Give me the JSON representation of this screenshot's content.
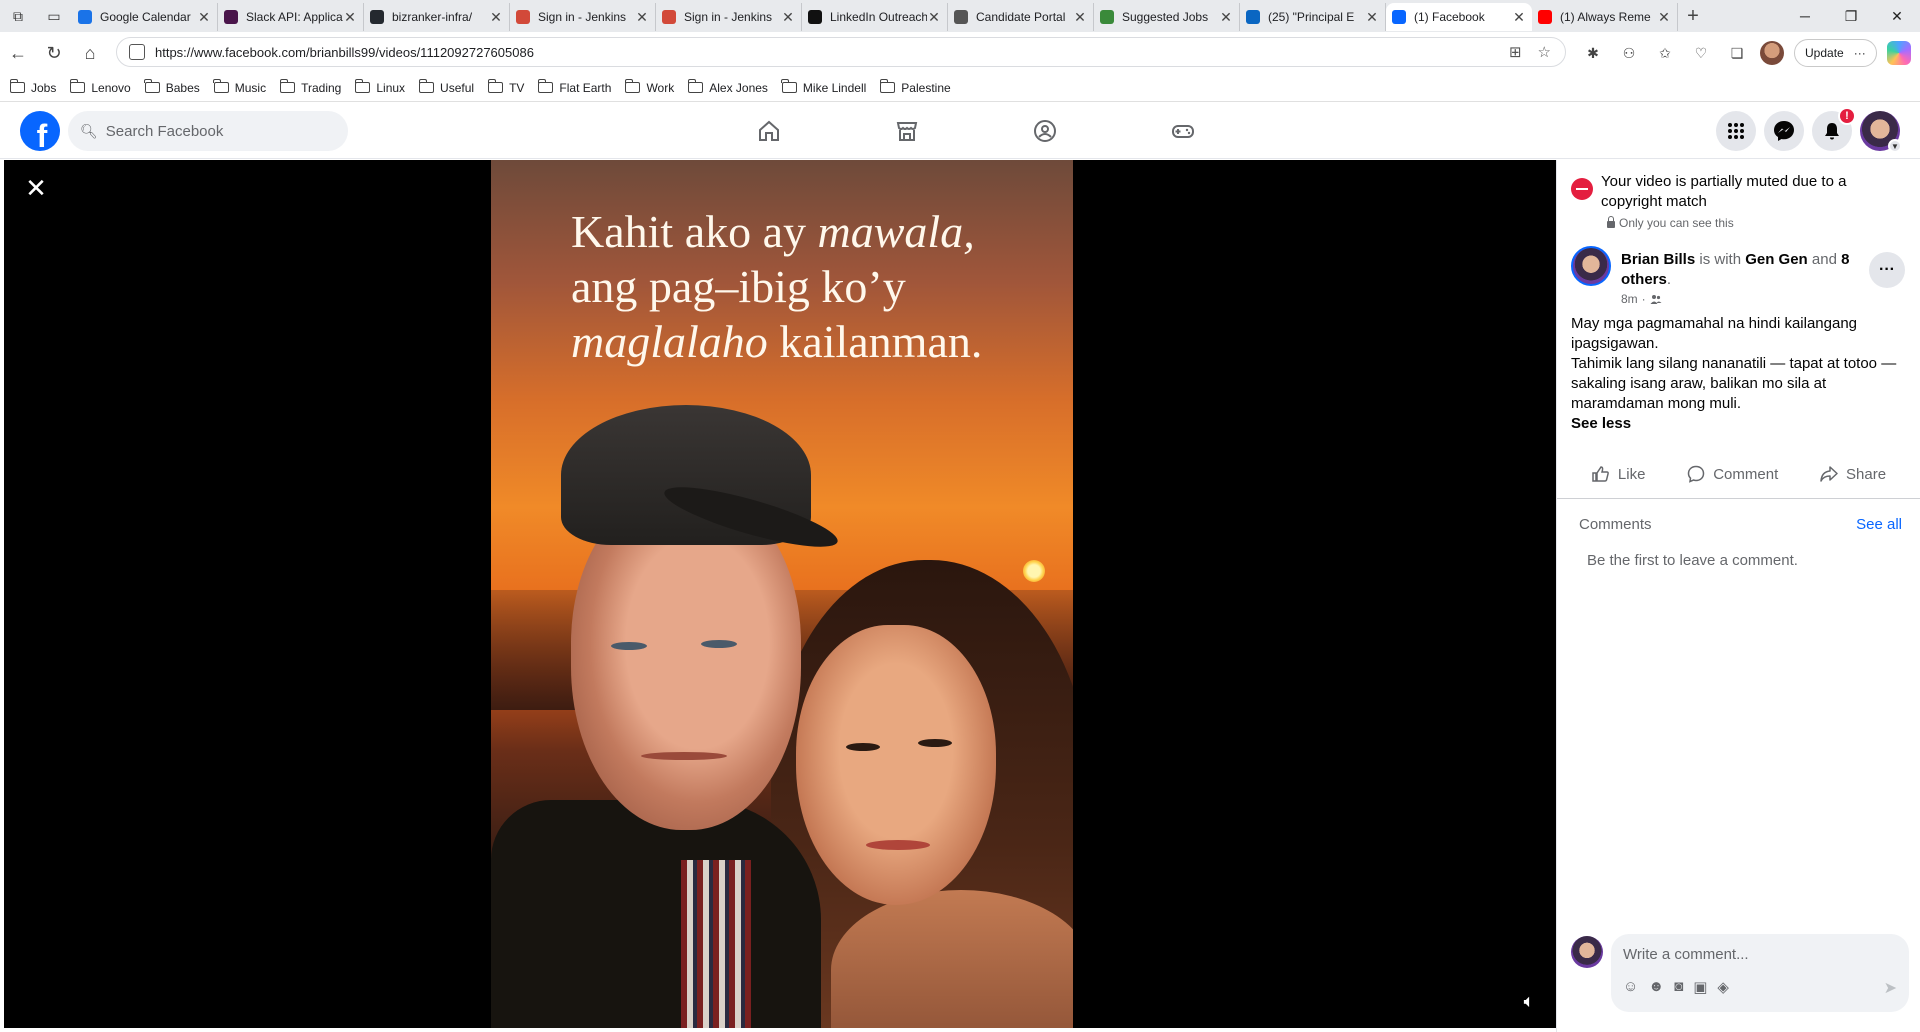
{
  "tabs": [
    {
      "title": "Google Calendar",
      "favicon": "calendar-icon",
      "color": "#1a73e8"
    },
    {
      "title": "Slack API: Applications",
      "favicon": "slack-icon",
      "color": "#4a154b"
    },
    {
      "title": "bizranker-infra/",
      "favicon": "github-icon",
      "color": "#24292f"
    },
    {
      "title": "Sign in - Jenkins",
      "favicon": "jenkins-icon",
      "color": "#d24939"
    },
    {
      "title": "Sign in - Jenkins",
      "favicon": "jenkins-icon",
      "color": "#d24939"
    },
    {
      "title": "LinkedIn Outreach",
      "favicon": "openai-icon",
      "color": "#111111"
    },
    {
      "title": "Candidate Portal",
      "favicon": "globe-icon",
      "color": "#555555"
    },
    {
      "title": "Suggested Jobs",
      "favicon": "jobs-icon",
      "color": "#3a8a3a"
    },
    {
      "title": "(25) \"Principal E",
      "favicon": "linkedin-icon",
      "color": "#0a66c2"
    },
    {
      "title": "(1) Facebook",
      "favicon": "facebook-icon",
      "color": "#0866ff",
      "active": true
    },
    {
      "title": "(1) Always Reme",
      "favicon": "youtube-icon",
      "color": "#ff0000"
    }
  ],
  "address": {
    "url": "https://www.facebook.com/brianbills99/videos/1112092727605086"
  },
  "toolbar": {
    "update_label": "Update"
  },
  "bookmarks": [
    "Jobs",
    "Lenovo",
    "Babes",
    "Music",
    "Trading",
    "Linux",
    "Useful",
    "TV",
    "Flat Earth",
    "Work",
    "Alex Jones",
    "Mike Lindell",
    "Palestine"
  ],
  "fb": {
    "logo_letter": "f",
    "search_placeholder": "Search Facebook",
    "notification_count": "!",
    "brand_color": "#0866ff"
  },
  "video": {
    "caption_line1_a": "Kahit ako ay ",
    "caption_line1_b": "mawala,",
    "caption_line2": "ang pag–ibig ko’y",
    "caption_line3_a": "maglalaho",
    "caption_line3_b": " kailanman."
  },
  "sidebar": {
    "copyright_notice": "Your video is partially muted due to a copyright match",
    "visibility": "Only you can see this",
    "author": "Brian Bills",
    "with_text": " is with ",
    "tagged": "Gen Gen",
    "and_text": " and ",
    "others": "8 others",
    "period": ".",
    "time": "8m",
    "post_lines": [
      "May mga pagmamahal na hindi kailangang ipagsigawan.",
      "Tahimik lang silang nananatili — tapat at totoo —",
      "sakaling isang araw, balikan mo sila at maramdaman mong muli."
    ],
    "see_less": "See less",
    "actions": {
      "like": "Like",
      "comment": "Comment",
      "share": "Share"
    },
    "comments_header": "Comments",
    "see_all": "See all",
    "empty_comments": "Be the first to leave a comment.",
    "comment_placeholder": "Write a comment..."
  }
}
